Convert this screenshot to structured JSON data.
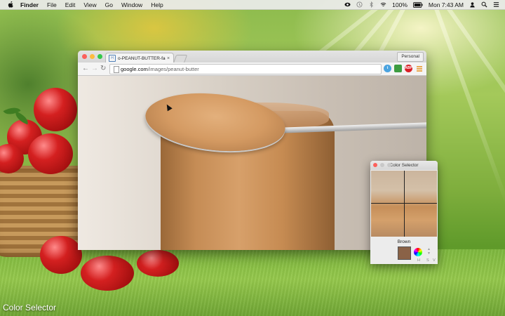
{
  "menubar": {
    "app_name": "Finder",
    "menus": [
      "File",
      "Edit",
      "View",
      "Go",
      "Window",
      "Help"
    ],
    "battery": "100%",
    "clock": "Mon 7:43 AM",
    "status_icons": [
      "eye-icon",
      "time-machine-icon",
      "bluetooth-icon",
      "wifi-icon",
      "battery-icon",
      "user-icon",
      "search-icon",
      "list-icon"
    ]
  },
  "browser": {
    "tab_title": "o-PEANUT-BUTTER-faceb",
    "tab_favicon": "H",
    "tab_close": "×",
    "profile_label": "Personal",
    "url_host": "google.com",
    "url_path": "/images/peanut-butter",
    "extensions": [
      "twitter-extension-icon",
      "green-extension-icon",
      "adblock-extension-icon",
      "menu-icon"
    ],
    "adblock_label": "ABP"
  },
  "color_selector": {
    "title": "Color Selector",
    "color_name": "Brown",
    "swatch_color": "#8a6247",
    "hsv_labels": [
      "H",
      "S",
      "V"
    ]
  },
  "caption": "Color Selector"
}
